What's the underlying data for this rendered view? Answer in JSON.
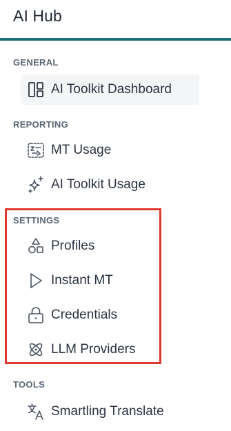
{
  "header": {
    "title": "AI Hub"
  },
  "sections": {
    "general": {
      "label": "GENERAL",
      "items": [
        {
          "label": "AI Toolkit Dashboard",
          "icon": "dashboard-icon",
          "active": true
        }
      ]
    },
    "reporting": {
      "label": "REPORTING",
      "items": [
        {
          "label": "MT Usage",
          "icon": "mt-usage-icon"
        },
        {
          "label": "AI Toolkit Usage",
          "icon": "sparkle-icon"
        }
      ]
    },
    "settings": {
      "label": "SETTINGS",
      "items": [
        {
          "label": "Profiles",
          "icon": "shapes-icon"
        },
        {
          "label": "Instant MT",
          "icon": "play-icon"
        },
        {
          "label": "Credentials",
          "icon": "lock-icon"
        },
        {
          "label": "LLM Providers",
          "icon": "atom-icon"
        }
      ]
    },
    "tools": {
      "label": "TOOLS",
      "items": [
        {
          "label": "Smartling Translate",
          "icon": "translate-icon"
        }
      ]
    }
  },
  "colors": {
    "accent_rule": "#1f6f78",
    "highlight_border": "#e03a2e",
    "active_bg": "#f4f5f7"
  }
}
